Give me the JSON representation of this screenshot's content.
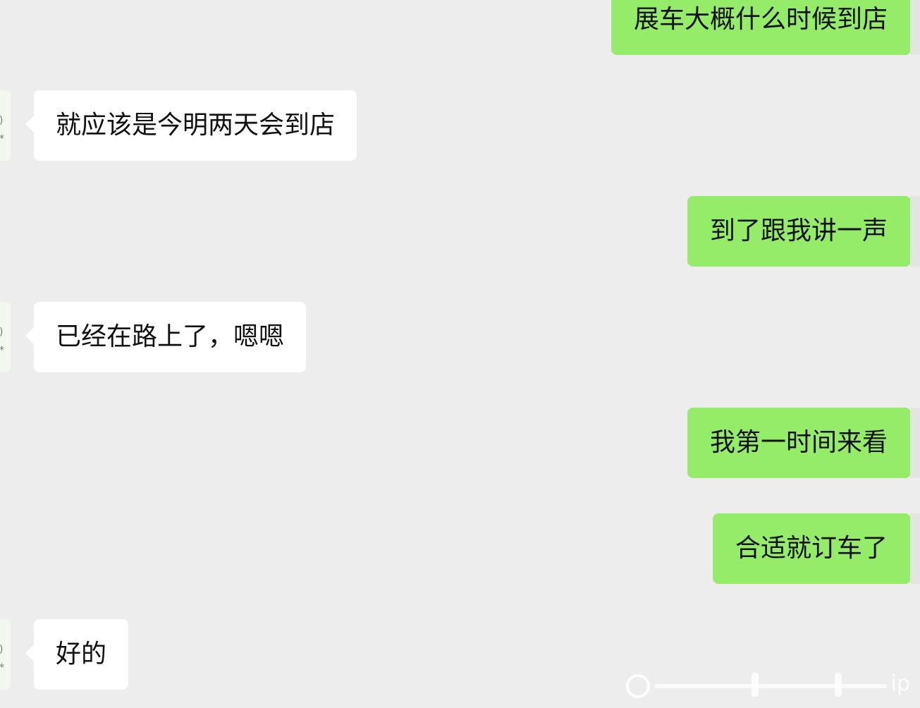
{
  "conversation": {
    "messages": [
      {
        "side": "outgoing",
        "text": "展车大概什么时候到店"
      },
      {
        "side": "incoming",
        "text": "就应该是今明两天会到店"
      },
      {
        "side": "outgoing",
        "text": "到了跟我讲一声"
      },
      {
        "side": "incoming",
        "text": "已经在路上了，嗯嗯"
      },
      {
        "side": "outgoing",
        "text": "我第一时间来看"
      },
      {
        "side": "outgoing",
        "text": "合适就订车了"
      },
      {
        "side": "incoming",
        "text": "好的"
      }
    ]
  },
  "watermark": {
    "text": "ip"
  },
  "colors": {
    "background": "#ededed",
    "outgoing_bubble": "#95ec69",
    "incoming_bubble": "#ffffff",
    "text": "#111111"
  }
}
